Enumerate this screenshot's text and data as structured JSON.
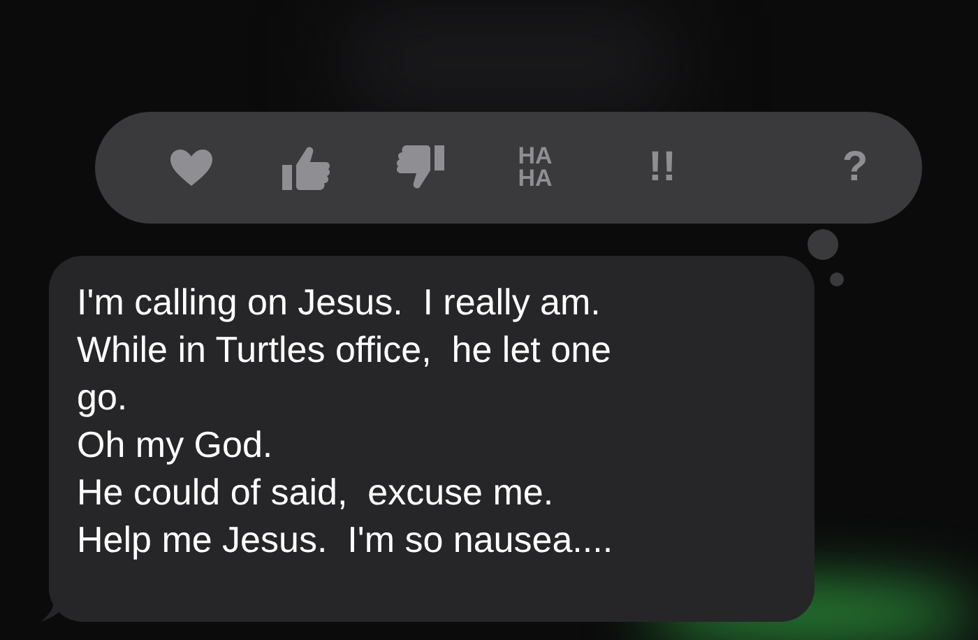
{
  "tapback_menu": {
    "reactions": [
      {
        "kind": "heart"
      },
      {
        "kind": "thumbs-up"
      },
      {
        "kind": "thumbs-down"
      },
      {
        "kind": "text",
        "label": "HA HA"
      },
      {
        "kind": "text",
        "label": "!!"
      },
      {
        "kind": "text",
        "label": "?"
      }
    ]
  },
  "message": {
    "lines": [
      "I'm calling on Jesus.  I really am.",
      "While in Turtles office,  he let one",
      "go.",
      "Oh my God.",
      "He could of said,  excuse me.",
      "Help me Jesus.  I'm so nausea...."
    ]
  }
}
